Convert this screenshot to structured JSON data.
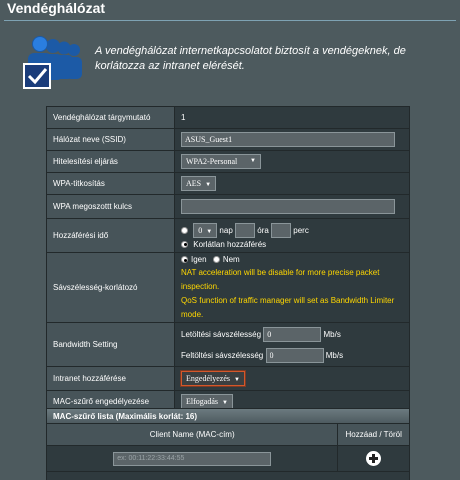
{
  "page": {
    "title": "Vendéghálózat",
    "description": "A vendéghálózat internetkapcsolatot biztosít a vendégeknek, de korlátozza az intranet elérését."
  },
  "form": {
    "index_label": "Vendéghálózat tárgymutató",
    "index_value": "1",
    "ssid_label": "Hálózat neve (SSID)",
    "ssid_value": "ASUS_Guest1",
    "auth_label": "Hitelesítési eljárás",
    "auth_value": "WPA2-Personal",
    "wpa_enc_label": "WPA-titkosítás",
    "wpa_enc_value": "AES",
    "wpa_key_label": "WPA megoszottt kulcs",
    "wpa_key_value": "",
    "access_label": "Hozzáférési idő",
    "access_day_value": "0",
    "access_day_unit": "nap",
    "access_hour_unit": "óra",
    "access_min_unit": "perc",
    "access_unlimited": "Korlátlan hozzáférés",
    "bw_label": "Sávszélesség-korlátozó",
    "bw_yes": "Igen",
    "bw_no": "Nem",
    "bw_warn1": "NAT acceleration will be disable for more precise packet inspection.",
    "bw_warn2": "QoS function of traffic manager will set as Bandwidth Limiter mode.",
    "bw_setting_label": "Bandwidth Setting",
    "download_label": "Letöltési sávszélesség",
    "download_value": "0",
    "download_unit": "Mb/s",
    "upload_label": "Feltöltési sávszélesség",
    "upload_value": "0",
    "upload_unit": "Mb/s",
    "intranet_label": "Intranet hozzáférése",
    "intranet_value": "Engedélyezés",
    "mac_filter_label": "MAC-szűrő engedélyezése",
    "mac_filter_value": "Elfogadás"
  },
  "mac_list": {
    "header": "MAC-szűrő lista (Maximális korlát: 16)",
    "col_client": "Client Name (MAC-cím)",
    "col_action": "Hozzáad / Töröl",
    "input_placeholder": "ex: 00:11:22:33:44:55"
  },
  "icons": {
    "hero": "guest-users-icon",
    "add": "add-circle-icon",
    "dropdown": "caret-down-icon"
  }
}
